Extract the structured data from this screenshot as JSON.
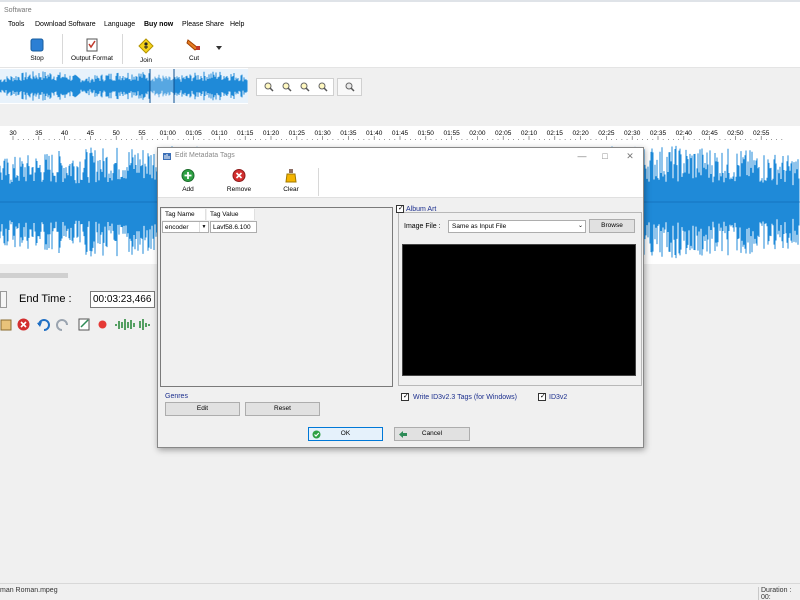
{
  "window": {
    "title": "Software"
  },
  "menu": [
    "Tools",
    "Download Software",
    "Language",
    "Buy now",
    "Please Share",
    "Help"
  ],
  "toolbar": {
    "stop": "Stop",
    "output_format": "Output Format",
    "join": "Join",
    "cut": "Cut"
  },
  "timeline": {
    "ticks": [
      "30",
      "35",
      "40",
      "45",
      "50",
      "55",
      "01:00",
      "01:05",
      "01:10",
      "01:15",
      "01:20",
      "01:25",
      "01:30",
      "01:35",
      "01:40",
      "01:45",
      "01:50",
      "01:55",
      "02:00",
      "02:05",
      "02:10",
      "02:15",
      "02:20",
      "02:25",
      "02:30",
      "02:35",
      "02:40",
      "02:45",
      "02:50",
      "02:55"
    ]
  },
  "end_time": {
    "label": "End Time :",
    "value": "00:03:23,466"
  },
  "status": {
    "file": "man Roman.mpeg",
    "duration": "Duration : 00:"
  },
  "dialog": {
    "title": "Edit Metadata Tags",
    "tools": {
      "add": "Add",
      "remove": "Remove",
      "clear": "Clear"
    },
    "tags": {
      "columns": [
        "Tag Name",
        "Tag Value"
      ],
      "rows": [
        {
          "name": "encoder",
          "value": "Lavf58.6.100"
        }
      ]
    },
    "genres": {
      "label": "Genres",
      "edit": "Edit",
      "reset": "Reset"
    },
    "album_art": {
      "label": "Album Art",
      "image_file_label": "Image File :",
      "image_file_value": "Same as Input File",
      "browse": "Browse"
    },
    "write_id3": "Write ID3v2.3 Tags (for Windows)",
    "id3v2": "ID3v2",
    "ok": "OK",
    "cancel": "Cancel"
  },
  "colors": {
    "wave": "#1f8ad8",
    "wave_selected": "#2f9be6",
    "accent_label": "#1c2f8e"
  }
}
